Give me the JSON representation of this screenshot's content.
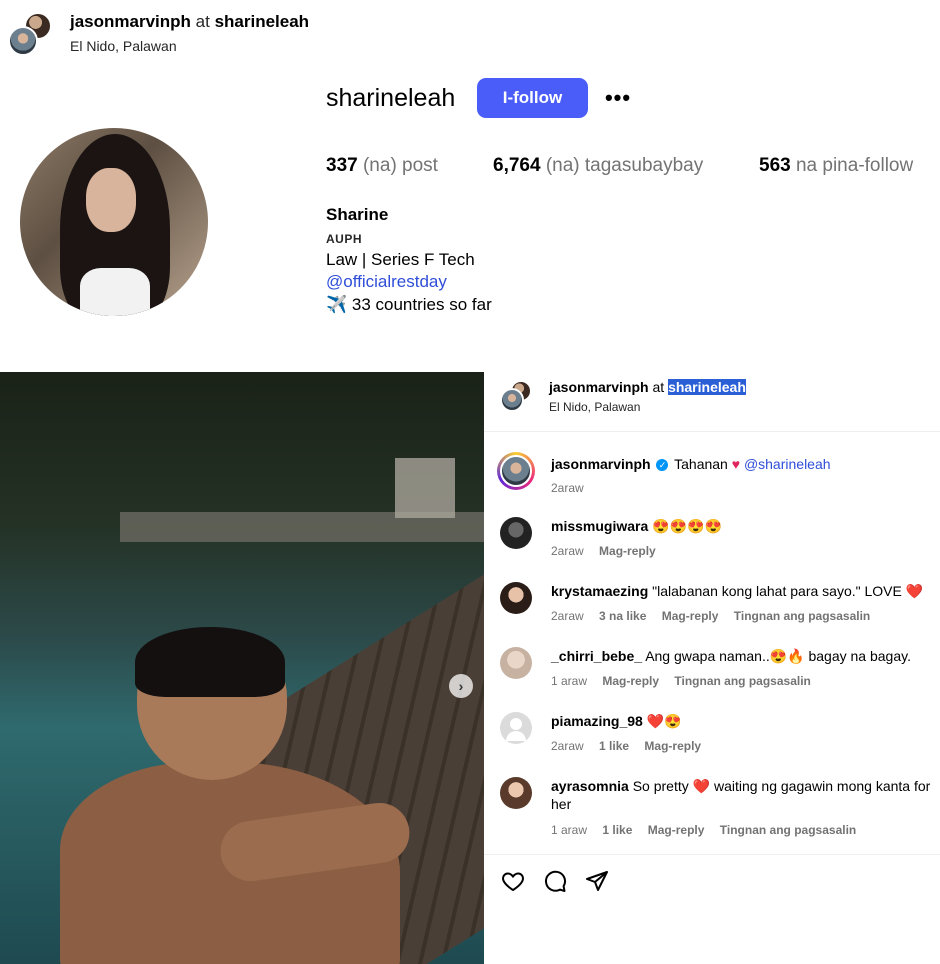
{
  "header": {
    "user": "jasonmarvinph",
    "at": "at",
    "tagged": "sharineleah",
    "location": "El Nido, Palawan"
  },
  "profile": {
    "username": "sharineleah",
    "follow_label": "I-follow",
    "more_label": "•••",
    "stats": {
      "posts_num": "337",
      "posts_label": "(na) post",
      "followers_num": "6,764",
      "followers_label": "(na) tagasubaybay",
      "following_num": "563",
      "following_label": "na pina-follow"
    },
    "bio": {
      "name": "Sharine",
      "category": "AUPH",
      "line1": "Law | Series F Tech",
      "link": "@officialrestday",
      "line3": "✈️ 33 countries so far"
    }
  },
  "post": {
    "next_label": "›",
    "header_user": "jasonmarvinph",
    "header_at": "at",
    "header_tagged": "sharineleah",
    "header_location": "El Nido, Palawan",
    "caption": {
      "user": "jasonmarvinph",
      "text": "Tahanan",
      "heart": "♥",
      "mention": "@sharineleah",
      "time": "2araw"
    },
    "comments": [
      {
        "user": "missmugiwara",
        "text": "😍😍😍😍",
        "time": "2araw",
        "likes": "",
        "reply": "Mag-reply",
        "translate": ""
      },
      {
        "user": "krystamaezing",
        "text": "\"lalabanan kong lahat para sayo.\" LOVE ❤️",
        "time": "2araw",
        "likes": "3 na like",
        "reply": "Mag-reply",
        "translate": "Tingnan ang pagsasalin"
      },
      {
        "user": "_chirri_bebe_",
        "text": "Ang gwapa naman..😍🔥 bagay na bagay.",
        "time": "1 araw",
        "likes": "",
        "reply": "Mag-reply",
        "translate": "Tingnan ang pagsasalin"
      },
      {
        "user": "piamazing_98",
        "text": "❤️😍",
        "time": "2araw",
        "likes": "1 like",
        "reply": "Mag-reply",
        "translate": ""
      },
      {
        "user": "ayrasomnia",
        "text": "So pretty ❤️ waiting ng gagawin mong kanta for her",
        "time": "1 araw",
        "likes": "1 like",
        "reply": "Mag-reply",
        "translate": "Tingnan ang pagsasalin"
      }
    ]
  }
}
